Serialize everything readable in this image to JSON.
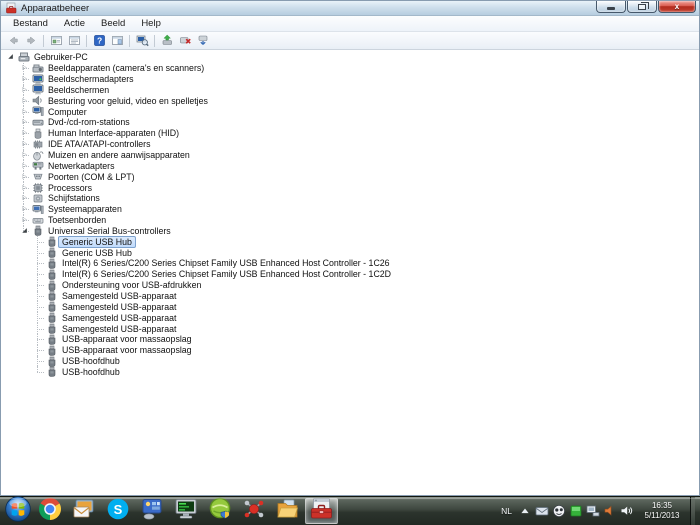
{
  "window": {
    "title": "Apparaatbeheer",
    "controls": [
      {
        "name": "minimize-button"
      },
      {
        "name": "restore-button"
      },
      {
        "name": "close-button"
      }
    ]
  },
  "menu": {
    "items": [
      "Bestand",
      "Actie",
      "Beeld",
      "Help"
    ]
  },
  "toolbar": {
    "buttons": [
      "back",
      "forward",
      "sep",
      "show-console-tree",
      "export-list",
      "sep",
      "help",
      "show-action-pane",
      "sep",
      "scan-hardware-changes",
      "sep",
      "update-driver",
      "uninstall-device",
      "disable-device"
    ]
  },
  "tree": {
    "items": [
      {
        "label": "Gebruiker-PC",
        "level": 0,
        "state": "expanded",
        "icon": "pc",
        "selected": false
      },
      {
        "label": "Beeldapparaten (camera's en scanners)",
        "level": 1,
        "state": "collapsed",
        "icon": "imaging",
        "selected": false
      },
      {
        "label": "Beeldschermadapters",
        "level": 1,
        "state": "collapsed",
        "icon": "display-adapter",
        "selected": false
      },
      {
        "label": "Beeldschermen",
        "level": 1,
        "state": "collapsed",
        "icon": "monitor",
        "selected": false
      },
      {
        "label": "Besturing voor geluid, video en spelletjes",
        "level": 1,
        "state": "collapsed",
        "icon": "audio",
        "selected": false
      },
      {
        "label": "Computer",
        "level": 1,
        "state": "collapsed",
        "icon": "computer",
        "selected": false
      },
      {
        "label": "Dvd-/cd-rom-stations",
        "level": 1,
        "state": "collapsed",
        "icon": "disc-drive",
        "selected": false
      },
      {
        "label": "Human Interface-apparaten (HID)",
        "level": 1,
        "state": "collapsed",
        "icon": "hid",
        "selected": false
      },
      {
        "label": "IDE ATA/ATAPI-controllers",
        "level": 1,
        "state": "collapsed",
        "icon": "ide",
        "selected": false
      },
      {
        "label": "Muizen en andere aanwijsapparaten",
        "level": 1,
        "state": "collapsed",
        "icon": "mouse",
        "selected": false
      },
      {
        "label": "Netwerkadapters",
        "level": 1,
        "state": "collapsed",
        "icon": "network",
        "selected": false
      },
      {
        "label": "Poorten (COM & LPT)",
        "level": 1,
        "state": "collapsed",
        "icon": "ports",
        "selected": false
      },
      {
        "label": "Processors",
        "level": 1,
        "state": "collapsed",
        "icon": "cpu",
        "selected": false
      },
      {
        "label": "Schijfstations",
        "level": 1,
        "state": "collapsed",
        "icon": "disk",
        "selected": false
      },
      {
        "label": "Systeemapparaten",
        "level": 1,
        "state": "collapsed",
        "icon": "system",
        "selected": false
      },
      {
        "label": "Toetsenborden",
        "level": 1,
        "state": "collapsed",
        "icon": "keyboard",
        "selected": false
      },
      {
        "label": "Universal Serial Bus-controllers",
        "level": 1,
        "state": "expanded",
        "icon": "usb",
        "selected": false
      },
      {
        "label": "Generic USB Hub",
        "level": 2,
        "state": "none",
        "icon": "usb",
        "selected": true
      },
      {
        "label": "Generic USB Hub",
        "level": 2,
        "state": "none",
        "icon": "usb",
        "selected": false
      },
      {
        "label": "Intel(R) 6 Series/C200 Series Chipset Family USB Enhanced Host Controller - 1C26",
        "level": 2,
        "state": "none",
        "icon": "usb",
        "selected": false
      },
      {
        "label": "Intel(R) 6 Series/C200 Series Chipset Family USB Enhanced Host Controller - 1C2D",
        "level": 2,
        "state": "none",
        "icon": "usb",
        "selected": false
      },
      {
        "label": "Ondersteuning voor USB-afdrukken",
        "level": 2,
        "state": "none",
        "icon": "usb",
        "selected": false
      },
      {
        "label": "Samengesteld USB-apparaat",
        "level": 2,
        "state": "none",
        "icon": "usb",
        "selected": false
      },
      {
        "label": "Samengesteld USB-apparaat",
        "level": 2,
        "state": "none",
        "icon": "usb",
        "selected": false
      },
      {
        "label": "Samengesteld USB-apparaat",
        "level": 2,
        "state": "none",
        "icon": "usb",
        "selected": false
      },
      {
        "label": "Samengesteld USB-apparaat",
        "level": 2,
        "state": "none",
        "icon": "usb",
        "selected": false
      },
      {
        "label": "USB-apparaat voor massaopslag",
        "level": 2,
        "state": "none",
        "icon": "usb",
        "selected": false
      },
      {
        "label": "USB-apparaat voor massaopslag",
        "level": 2,
        "state": "none",
        "icon": "usb",
        "selected": false
      },
      {
        "label": "USB-hoofdhub",
        "level": 2,
        "state": "none",
        "icon": "usb",
        "selected": false
      },
      {
        "label": "USB-hoofdhub",
        "level": 2,
        "state": "none",
        "icon": "usb",
        "selected": false
      }
    ]
  },
  "taskbar": {
    "apps": [
      {
        "name": "chrome",
        "active": false
      },
      {
        "name": "windows-live-mail",
        "active": false
      },
      {
        "name": "skype",
        "active": false
      },
      {
        "name": "display-panel",
        "active": false
      },
      {
        "name": "terminal-monitor",
        "active": false
      },
      {
        "name": "security-globe",
        "active": false
      },
      {
        "name": "red-molecule",
        "active": false
      },
      {
        "name": "windows-explorer",
        "active": false
      },
      {
        "name": "device-manager",
        "active": true
      }
    ],
    "tray": {
      "language": "NL",
      "icons": [
        "hidden-icons",
        "mail",
        "panda-disc",
        "green-status",
        "network-devices",
        "audio-mixer",
        "volume"
      ],
      "time": "16:35",
      "date": "5/11/2013"
    }
  },
  "colors": {
    "selection_border": "#7da2ce",
    "selection_fill": "#c1dbfc",
    "titlebar": "#cfdfec",
    "taskbar": "#2c342d",
    "close_button": "#c4402f"
  }
}
